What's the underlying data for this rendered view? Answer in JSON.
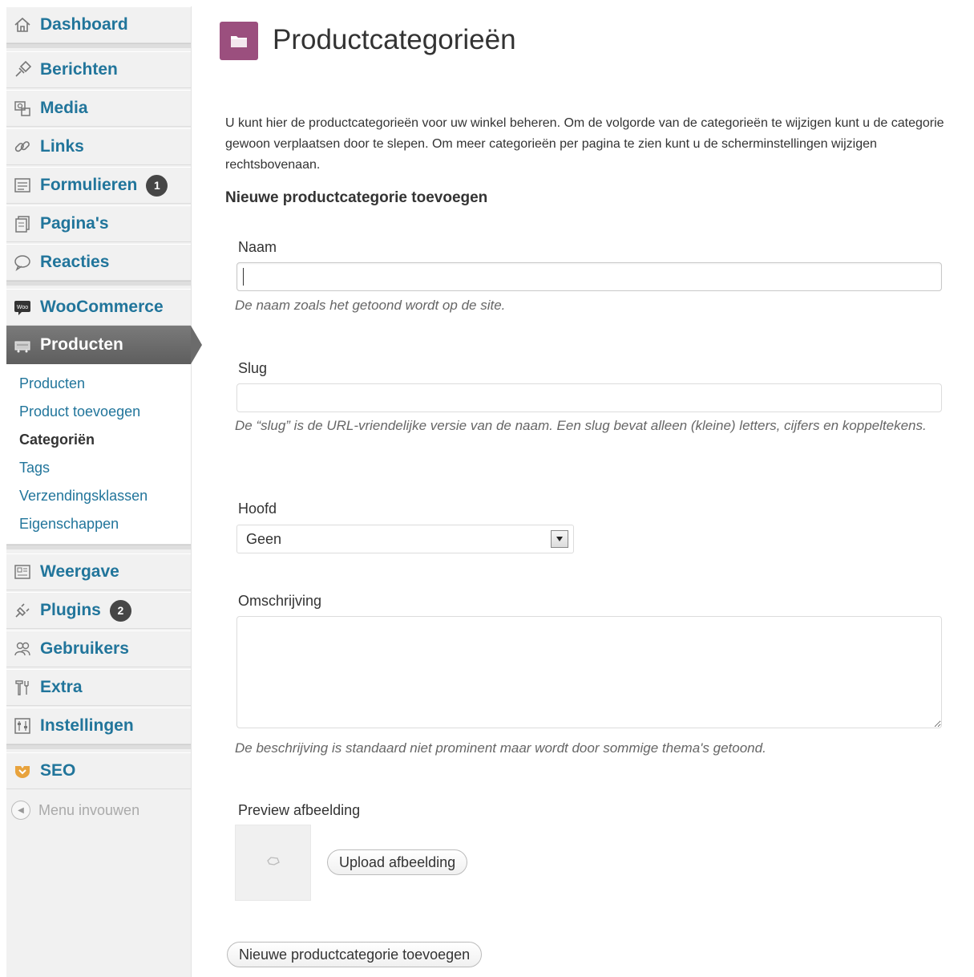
{
  "sidebar": {
    "dashboard": "Dashboard",
    "berichten": "Berichten",
    "media": "Media",
    "links": "Links",
    "formulieren": "Formulieren",
    "formulieren_badge": "1",
    "paginas": "Pagina's",
    "reacties": "Reacties",
    "woocommerce": "WooCommerce",
    "woo_logo_text": "Woo",
    "producten": "Producten",
    "submenu": {
      "producten": "Producten",
      "product_toevoegen": "Product toevoegen",
      "categorien": "Categoriën",
      "tags": "Tags",
      "verzendingsklassen": "Verzendingsklassen",
      "eigenschappen": "Eigenschappen"
    },
    "weergave": "Weergave",
    "plugins": "Plugins",
    "plugins_badge": "2",
    "gebruikers": "Gebruikers",
    "extra": "Extra",
    "instellingen": "Instellingen",
    "seo": "SEO",
    "collapse": "Menu invouwen",
    "link_color": "#21759b"
  },
  "main": {
    "title": "Productcategorieën",
    "intro": "U kunt hier de productcategorieën voor uw winkel beheren. Om de volgorde van de categorieën te wijzigen kunt u de categorie gewoon verplaatsen door te slepen. Om meer categorieën per pagina te zien kunt u de scherminstellingen wijzigen rechtsbovenaan.",
    "form_heading": "Nieuwe productcategorie toevoegen",
    "name_label": "Naam",
    "name_value": "",
    "name_hint": "De naam zoals het getoond wordt op de site.",
    "slug_label": "Slug",
    "slug_value": "",
    "slug_hint": "De “slug” is de URL-vriendelijke versie van de naam. Een slug bevat alleen (kleine) letters, cijfers en koppeltekens.",
    "parent_label": "Hoofd",
    "parent_value": "Geen",
    "description_label": "Omschrijving",
    "description_value": "",
    "description_hint": "De beschrijving is standaard niet prominent maar wordt door sommige thema's getoond.",
    "preview_label": "Preview afbeelding",
    "upload_button": "Upload afbeelding",
    "submit_button": "Nieuwe productcategorie toevoegen",
    "accent_color": "#9b4f7e"
  }
}
